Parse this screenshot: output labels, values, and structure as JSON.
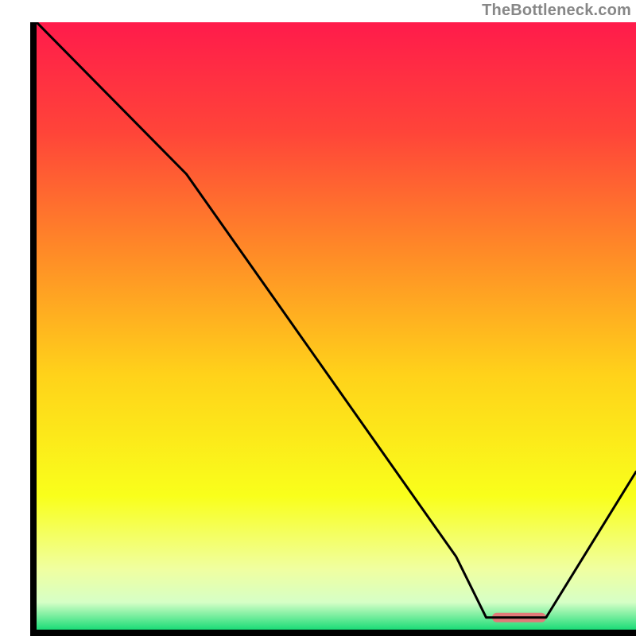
{
  "watermark": "TheBottleneck.com",
  "chart_data": {
    "type": "line",
    "title": "",
    "xlabel": "",
    "ylabel": "",
    "xlim": [
      0,
      100
    ],
    "ylim": [
      0,
      100
    ],
    "grid": false,
    "legend": false,
    "background_gradient": {
      "orientation": "vertical",
      "stops": [
        {
          "offset": 0.0,
          "color": "#ff1b4b"
        },
        {
          "offset": 0.18,
          "color": "#ff4439"
        },
        {
          "offset": 0.38,
          "color": "#ff8b27"
        },
        {
          "offset": 0.58,
          "color": "#ffd21a"
        },
        {
          "offset": 0.78,
          "color": "#f9ff1b"
        },
        {
          "offset": 0.9,
          "color": "#f0ffa0"
        },
        {
          "offset": 0.955,
          "color": "#d6ffc6"
        },
        {
          "offset": 1.0,
          "color": "#1bdc77"
        }
      ]
    },
    "series": [
      {
        "name": "bottleneck-curve",
        "color": "#000000",
        "width": 3,
        "x": [
          0,
          10,
          20,
          25,
          30,
          40,
          50,
          60,
          70,
          75,
          80,
          85,
          90,
          100
        ],
        "y": [
          100,
          90,
          80,
          75,
          68,
          54,
          40,
          26,
          12,
          2,
          2,
          2,
          10,
          26
        ]
      }
    ],
    "optimum_band": {
      "name": "optimum-marker",
      "color": "#e17a79",
      "x_start": 76,
      "x_end": 85,
      "y": 2,
      "thickness_px": 12
    }
  }
}
